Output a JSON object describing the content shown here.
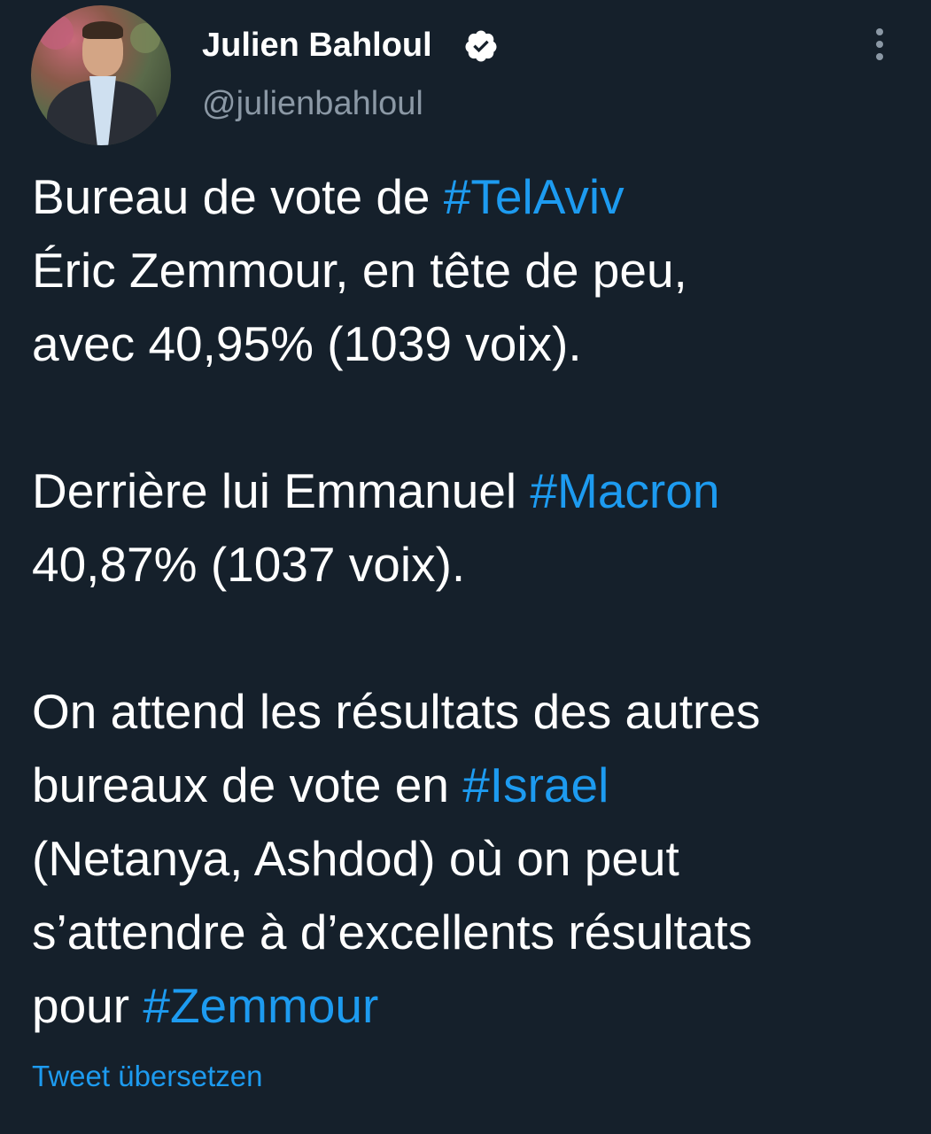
{
  "author": {
    "display_name": "Julien Bahloul",
    "handle": "@julienbahloul",
    "verified": true
  },
  "icons": {
    "verified": "verified-badge-icon",
    "more": "more-vertical-icon"
  },
  "colors": {
    "background": "#15202b",
    "text": "#ffffff",
    "secondary": "#8b98a5",
    "link": "#1d9bf0"
  },
  "tweet": {
    "p1": {
      "l1_text": "Bureau de vote de ",
      "l1_tag": "#TelAviv",
      "l2": "Éric Zemmour, en tête de peu,",
      "l3": "avec 40,95% (1039 voix)."
    },
    "p2": {
      "l1_text": "Derrière lui Emmanuel ",
      "l1_tag": "#Macron",
      "l2": "40,87% (1037 voix)."
    },
    "p3": {
      "l1": "On attend les résultats des autres",
      "l2_text": "bureaux de vote en ",
      "l2_tag": "#Israel",
      "l3": "(Netanya, Ashdod) où on peut",
      "l4": "s’attendre à d’excellents résultats",
      "l5_text": "pour ",
      "l5_tag": "#Zemmour"
    }
  },
  "translate_label": "Tweet übersetzen"
}
